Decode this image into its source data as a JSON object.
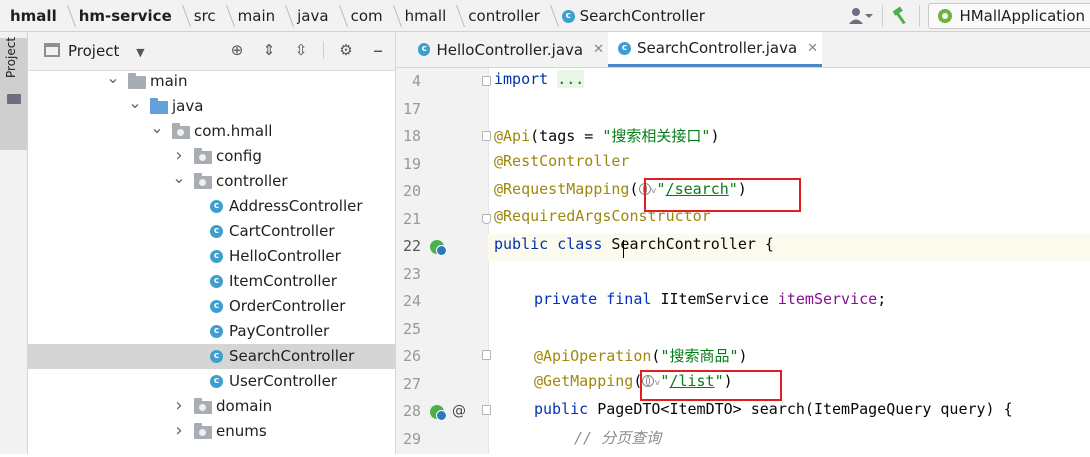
{
  "breadcrumb": [
    "hmall",
    "hm-service",
    "src",
    "main",
    "java",
    "com",
    "hmall",
    "controller",
    "SearchController"
  ],
  "run_config": "HMallApplication",
  "left_strip": {
    "label": "Project"
  },
  "project_panel": {
    "title": "Project",
    "tree": [
      {
        "label": "main",
        "kind": "folder",
        "expanded": true,
        "depth": 0
      },
      {
        "label": "java",
        "kind": "source-folder",
        "expanded": true,
        "depth": 1
      },
      {
        "label": "com.hmall",
        "kind": "package",
        "expanded": true,
        "depth": 2
      },
      {
        "label": "config",
        "kind": "package",
        "expanded": false,
        "depth": 3
      },
      {
        "label": "controller",
        "kind": "package",
        "expanded": true,
        "depth": 3
      },
      {
        "label": "AddressController",
        "kind": "class",
        "depth": 4
      },
      {
        "label": "CartController",
        "kind": "class",
        "depth": 4
      },
      {
        "label": "HelloController",
        "kind": "class",
        "depth": 4
      },
      {
        "label": "ItemController",
        "kind": "class",
        "depth": 4
      },
      {
        "label": "OrderController",
        "kind": "class",
        "depth": 4
      },
      {
        "label": "PayController",
        "kind": "class",
        "depth": 4
      },
      {
        "label": "SearchController",
        "kind": "class",
        "depth": 4,
        "selected": true
      },
      {
        "label": "UserController",
        "kind": "class",
        "depth": 4
      },
      {
        "label": "domain",
        "kind": "package",
        "expanded": false,
        "depth": 3
      },
      {
        "label": "enums",
        "kind": "package",
        "expanded": false,
        "depth": 3
      }
    ]
  },
  "tabs": [
    {
      "label": "HelloController.java",
      "active": false
    },
    {
      "label": "SearchController.java",
      "active": true
    }
  ],
  "class_icon_letter": "c",
  "editor": {
    "line_numbers": [
      "4",
      "17",
      "18",
      "19",
      "20",
      "21",
      "22",
      "23",
      "24",
      "25",
      "26",
      "27",
      "28",
      "29"
    ],
    "current_line": "22",
    "code": {
      "l4_kw": "import",
      "l4_fold": "...",
      "l18_ann": "@Api",
      "l18_mid": "(tags = ",
      "l18_str": "\"搜索相关接口\"",
      "l18_end": ")",
      "l19_ann": "@RestController",
      "l20_ann": "@RequestMapping",
      "l20_open": "(",
      "l20_q1": "\"",
      "l20_path": "/search",
      "l20_q2": "\"",
      "l20_end": ")",
      "l21_ann": "@RequiredArgsConstructor",
      "l22_kw": "public class ",
      "l22_rest": "SearchController {",
      "l24_kw": "private final ",
      "l24_type": "IItemService ",
      "l24_field": "itemService",
      "l24_end": ";",
      "l26_ann": "@ApiOperation",
      "l26_open": "(",
      "l26_str": "\"搜索商品\"",
      "l26_end": ")",
      "l27_ann": "@GetMapping",
      "l27_open": "(",
      "l27_q1": "\"",
      "l27_path": "/list",
      "l27_q2": "\"",
      "l27_end": ")",
      "l28_kw": "public ",
      "l28_rest": "PageDTO<ItemDTO> search(ItemPageQuery query) {",
      "l29_cmt": "// 分页查询"
    },
    "gutter_marks": {
      "at_symbol": "@"
    }
  },
  "colors": {
    "keyword": "#0033b3",
    "annotation": "#9e880d",
    "string": "#067d17",
    "field": "#871094",
    "highlight_box": "#e02020",
    "selection": "#d5d5d5"
  }
}
